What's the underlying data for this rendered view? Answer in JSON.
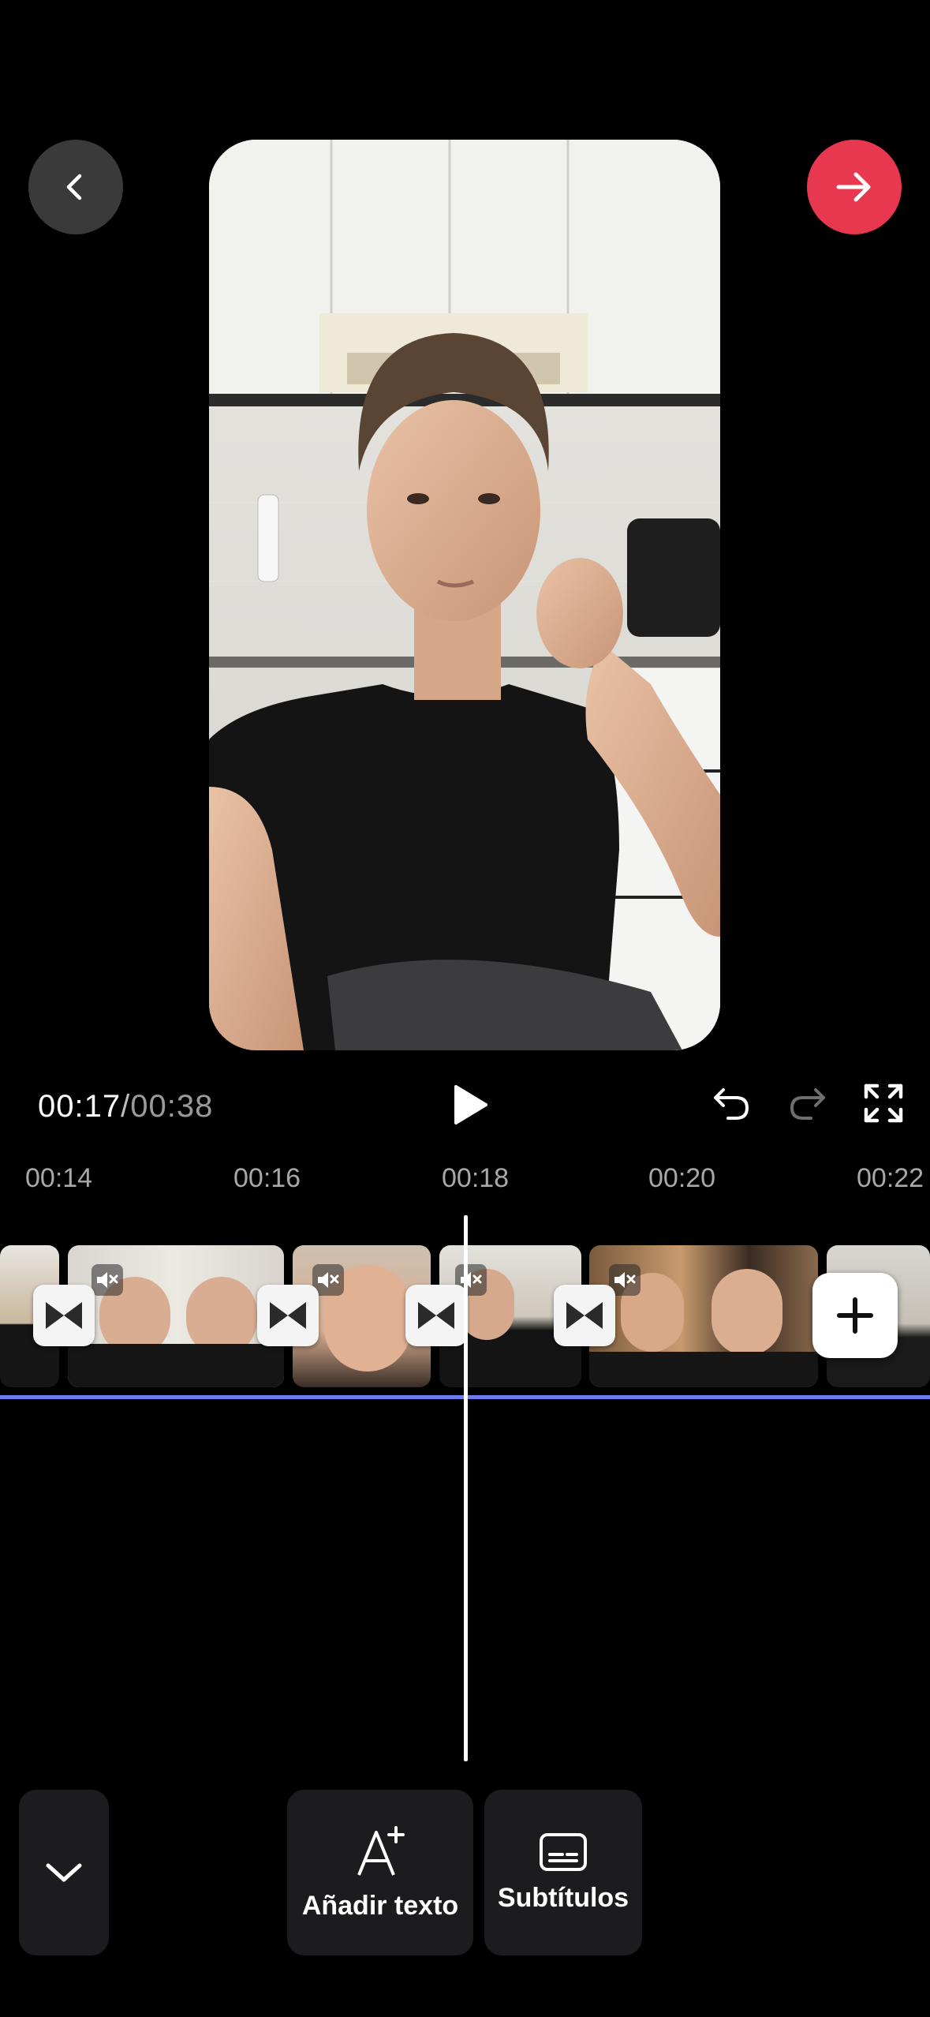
{
  "header": {
    "back_icon": "chevron-left-icon",
    "next_icon": "arrow-right-icon",
    "next_color": "#e8384f"
  },
  "playback": {
    "current_time": "00:17",
    "separator": "/",
    "total_time": "00:38",
    "play_icon": "play-icon",
    "undo_icon": "undo-icon",
    "redo_icon": "redo-icon",
    "fullscreen_icon": "fullscreen-icon"
  },
  "timeline": {
    "ticks": [
      "00:14",
      "00:16",
      "00:18",
      "00:20",
      "00:22"
    ],
    "clips_muted": true,
    "playhead_color": "#ffffff",
    "track_color": "#6f7cf0"
  },
  "toolbar": {
    "collapse_icon": "chevron-down-icon",
    "add_text_label": "Añadir texto",
    "subtitles_label": "Subtítulos"
  }
}
